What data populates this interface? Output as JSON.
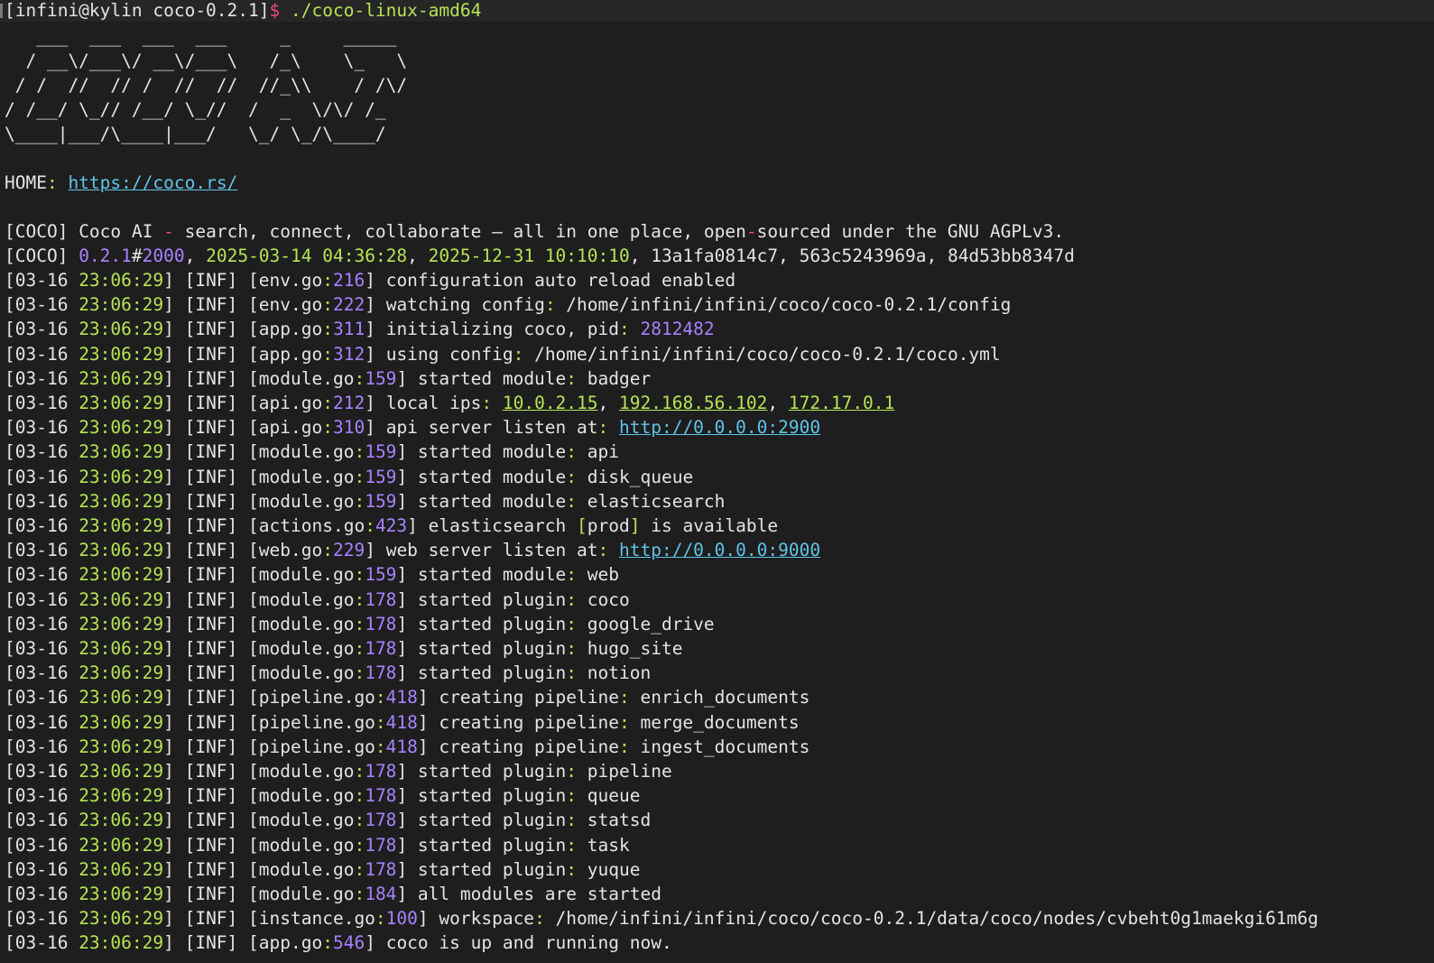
{
  "prompt": {
    "user_host_dir": "[infini@kylin coco-0.2.1]",
    "symbol": "$",
    "command": " ./coco-linux-amd64"
  },
  "banner": [
    "   ___  ___  ___  ___     _     _____",
    "  / __\\/___\\/ __\\/___\\   /_\\    \\_   \\",
    " / /  //  // /  //  //  //_\\\\    / /\\/",
    "/ /__/ \\_// /__/ \\_//  /  _  \\/\\/ /_",
    "\\____|___/\\____|___/   \\_/ \\_/\\____/"
  ],
  "home": {
    "label": "HOME",
    "url": "https://coco.rs/"
  },
  "coco_info": {
    "tag": "[COCO]",
    "description_a": " Coco AI ",
    "description_dash": "-",
    "description_b": " search, connect, collaborate — all in one place, open",
    "description_dash2": "-",
    "description_c": "sourced under the GNU AGPLv3.",
    "version": "0.2.1",
    "build_hash": "#",
    "build_num": "2000",
    "build_date": "2025-03-14 04:36:28",
    "expire_date": "2025-12-31 10:10:10",
    "commit1": "13a1fa0814c7",
    "commit2": "563c5243969a",
    "commit3": "84d53bb8347d"
  },
  "log_prefix": {
    "date": "03-16",
    "time": "23:06:29",
    "level": "INF"
  },
  "logs": [
    {
      "file": "env.go",
      "line": "216",
      "msg": "configuration auto reload enabled"
    },
    {
      "file": "env.go",
      "line": "222",
      "msg": "watching config",
      "value": "/home/infini/infini/coco/coco-0.2.1/config"
    },
    {
      "file": "app.go",
      "line": "311",
      "msg": "initializing coco, pid",
      "value": "2812482"
    },
    {
      "file": "app.go",
      "line": "312",
      "msg": "using config",
      "value": "/home/infini/infini/coco/coco-0.2.1/coco.yml"
    },
    {
      "file": "module.go",
      "line": "159",
      "msg": "started module",
      "value": "badger"
    },
    {
      "file": "api.go",
      "line": "212",
      "msg": "local ips",
      "ips": [
        "10.0.2.15",
        "192.168.56.102",
        "172.17.0.1"
      ]
    },
    {
      "file": "api.go",
      "line": "310",
      "msg": "api server listen at",
      "url": "http://0.0.0.0:2900"
    },
    {
      "file": "module.go",
      "line": "159",
      "msg": "started module",
      "value": "api"
    },
    {
      "file": "module.go",
      "line": "159",
      "msg": "started module",
      "value": "disk_queue"
    },
    {
      "file": "module.go",
      "line": "159",
      "msg": "started module",
      "value": "elasticsearch"
    },
    {
      "file": "actions.go",
      "line": "423",
      "msg": "elasticsearch",
      "tag": "prod",
      "tail": "is available"
    },
    {
      "file": "web.go",
      "line": "229",
      "msg": "web server listen at",
      "url": "http://0.0.0.0:9000"
    },
    {
      "file": "module.go",
      "line": "159",
      "msg": "started module",
      "value": "web"
    },
    {
      "file": "module.go",
      "line": "178",
      "msg": "started plugin",
      "value": "coco"
    },
    {
      "file": "module.go",
      "line": "178",
      "msg": "started plugin",
      "value": "google_drive"
    },
    {
      "file": "module.go",
      "line": "178",
      "msg": "started plugin",
      "value": "hugo_site"
    },
    {
      "file": "module.go",
      "line": "178",
      "msg": "started plugin",
      "value": "notion"
    },
    {
      "file": "pipeline.go",
      "line": "418",
      "msg": "creating pipeline",
      "value": "enrich_documents"
    },
    {
      "file": "pipeline.go",
      "line": "418",
      "msg": "creating pipeline",
      "value": "merge_documents"
    },
    {
      "file": "pipeline.go",
      "line": "418",
      "msg": "creating pipeline",
      "value": "ingest_documents"
    },
    {
      "file": "module.go",
      "line": "178",
      "msg": "started plugin",
      "value": "pipeline"
    },
    {
      "file": "module.go",
      "line": "178",
      "msg": "started plugin",
      "value": "queue"
    },
    {
      "file": "module.go",
      "line": "178",
      "msg": "started plugin",
      "value": "statsd"
    },
    {
      "file": "module.go",
      "line": "178",
      "msg": "started plugin",
      "value": "task"
    },
    {
      "file": "module.go",
      "line": "178",
      "msg": "started plugin",
      "value": "yuque"
    },
    {
      "file": "module.go",
      "line": "184",
      "msg": "all modules are started"
    },
    {
      "file": "instance.go",
      "line": "100",
      "msg": "workspace",
      "value": "/home/infini/infini/coco/coco-0.2.1/data/coco/nodes/cvbeht0g1maekgi61m6g"
    },
    {
      "file": "app.go",
      "line": "546",
      "msg": "coco is up and running now."
    }
  ],
  "colors": {
    "background": "#1e1e1e",
    "text": "#e4e4e4",
    "green": "#b6e354",
    "purple": "#a882ff",
    "cyan": "#5fc4e8",
    "pink": "#e84a8a"
  }
}
